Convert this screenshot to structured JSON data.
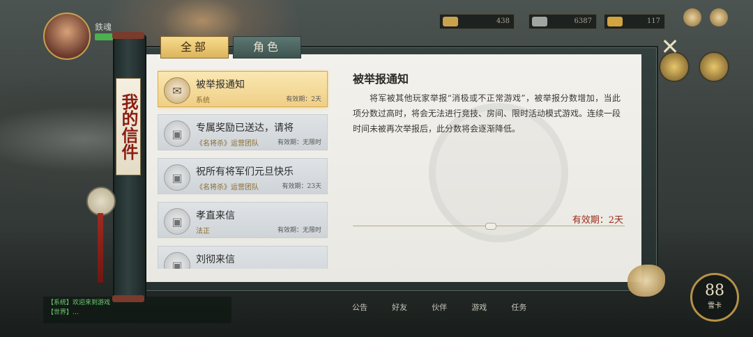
{
  "hud": {
    "player_name": "鉄魂",
    "resources": [
      "438",
      "6387",
      "117"
    ],
    "power_value": "88",
    "power_label": "雪卡",
    "bottom_menu": [
      "公告",
      "好友",
      "伙伴",
      "游戏",
      "任务"
    ],
    "chat_lines": [
      "【系统】欢迎来到游戏",
      "【世界】…"
    ]
  },
  "window": {
    "side_label": "我的信件",
    "close_label": "✕"
  },
  "tabs": [
    {
      "label": "全部",
      "active": true
    },
    {
      "label": "角色",
      "active": false
    }
  ],
  "mails": [
    {
      "title": "被举报通知",
      "sender": "系统",
      "expiry": "有效期：2天",
      "selected": true,
      "icon": "report-envelope-icon"
    },
    {
      "title": "专属奖励已送达，请将",
      "sender": "《名将杀》运营团队",
      "expiry": "有效期：无限时",
      "selected": false,
      "icon": "chest-icon"
    },
    {
      "title": "祝所有将军们元旦快乐",
      "sender": "《名将杀》运营团队",
      "expiry": "有效期：23天",
      "selected": false,
      "icon": "chest-icon"
    },
    {
      "title": "孝直来信",
      "sender": "法正",
      "expiry": "有效期：无限时",
      "selected": false,
      "icon": "chest-icon"
    },
    {
      "title": "刘彻来信",
      "sender": "",
      "expiry": "",
      "selected": false,
      "icon": "chest-icon"
    }
  ],
  "detail": {
    "title": "被举报通知",
    "body": "将军被其他玩家举报“消极或不正常游戏”，被举报分数增加，当此项分数过高时，将会无法进行竞技、房间、限时活动模式游戏。连续一段时间未被再次举报后，此分数将会逐渐降低。",
    "expiry": "有效期：2天"
  }
}
